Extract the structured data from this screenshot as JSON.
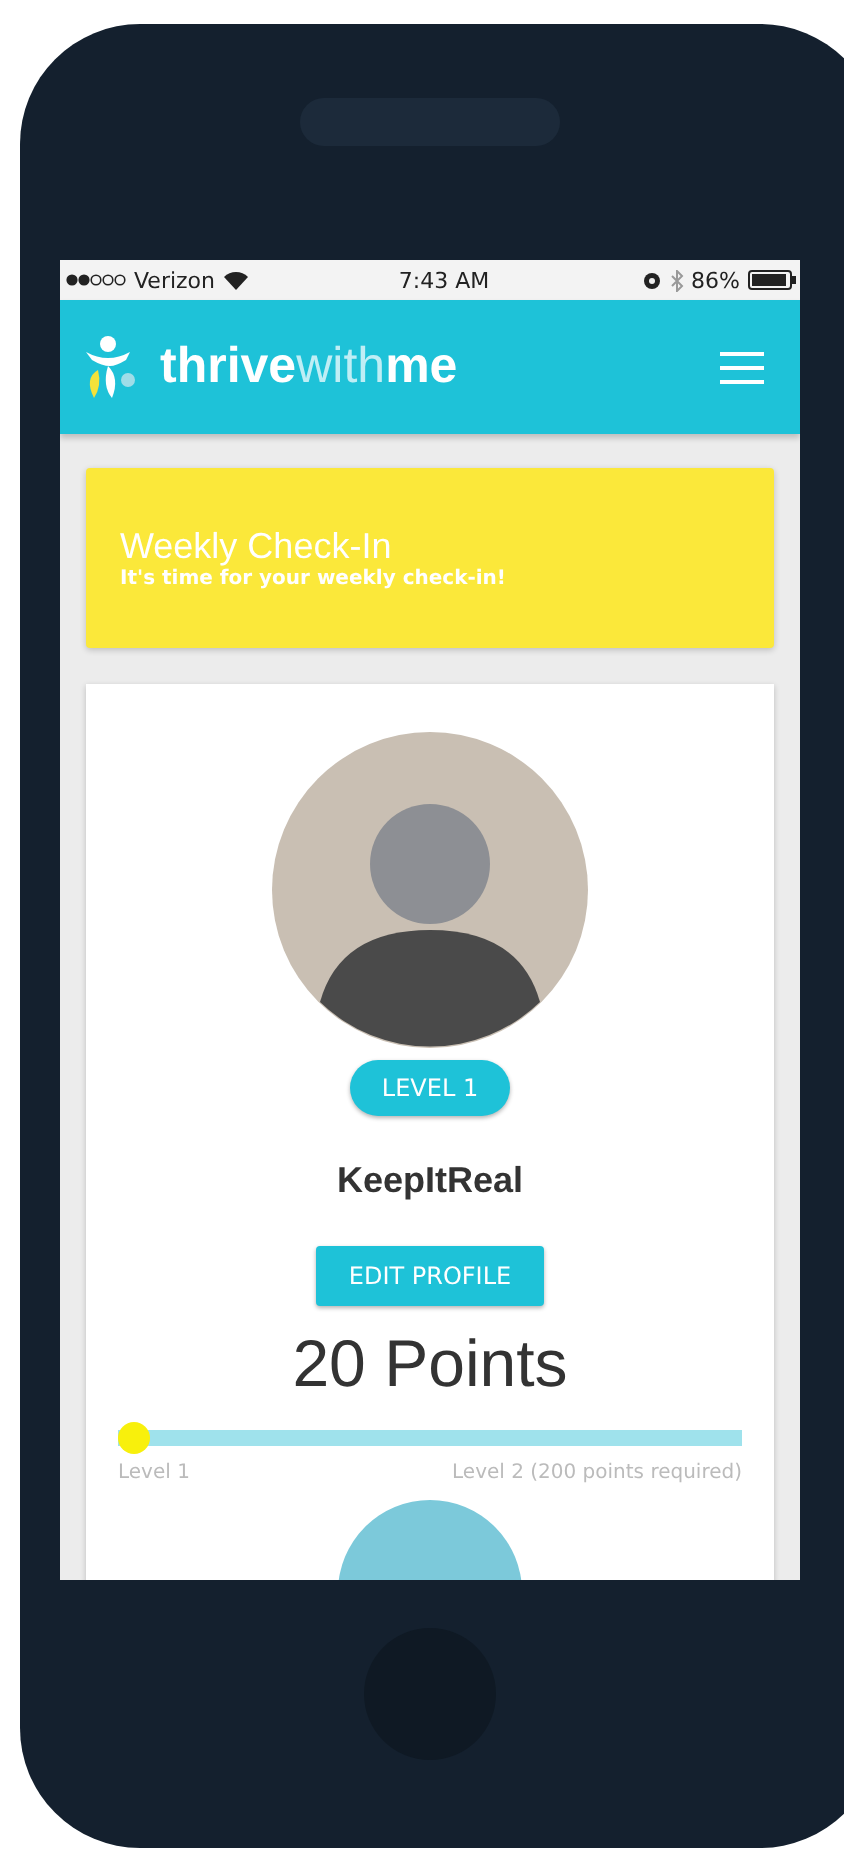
{
  "status_bar": {
    "carrier": "Verizon",
    "time": "7:43 AM",
    "battery": "86%"
  },
  "header": {
    "brand": [
      {
        "text": "thrive",
        "kind": "strong"
      },
      {
        "text": "with",
        "kind": "light"
      },
      {
        "text": "me",
        "kind": "strong"
      }
    ]
  },
  "checkin_card": {
    "title": "Weekly Check-In",
    "subtitle": "It's time for your weekly check-in!"
  },
  "profile": {
    "level_badge": "LEVEL 1",
    "username": "KeepItReal",
    "edit_button": "EDIT PROFILE",
    "points": "20 Points",
    "progress": {
      "level": 0,
      "start_label": "Level 1",
      "end_label": "Level 2 (200 points required)"
    }
  }
}
